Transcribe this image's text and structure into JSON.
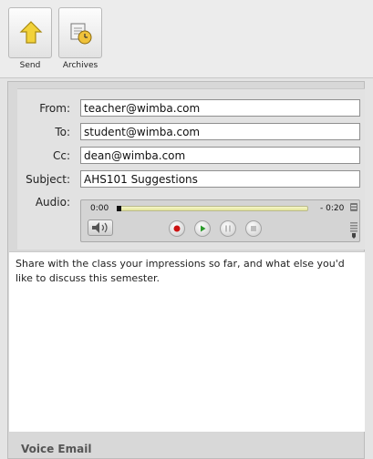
{
  "toolbar": {
    "send_label": "Send",
    "archives_label": "Archives"
  },
  "form": {
    "from_label": "From:",
    "from_value": "teacher@wimba.com",
    "to_label": "To:",
    "to_value": "student@wimba.com",
    "cc_label": "Cc:",
    "cc_value": "dean@wimba.com",
    "subject_label": "Subject:",
    "subject_value": "AHS101 Suggestions",
    "audio_label": "Audio:"
  },
  "audio": {
    "current_time": "0:00",
    "remaining_time": "- 0:20",
    "progress": 0
  },
  "message": {
    "body": "Share with the class your impressions so far, and what else you'd like to discuss this semester."
  },
  "footer": {
    "title": "Voice Email"
  },
  "colors": {
    "record": "#cc1111",
    "play": "#2b9b2b",
    "progress_fill": "#e8ea9e"
  }
}
